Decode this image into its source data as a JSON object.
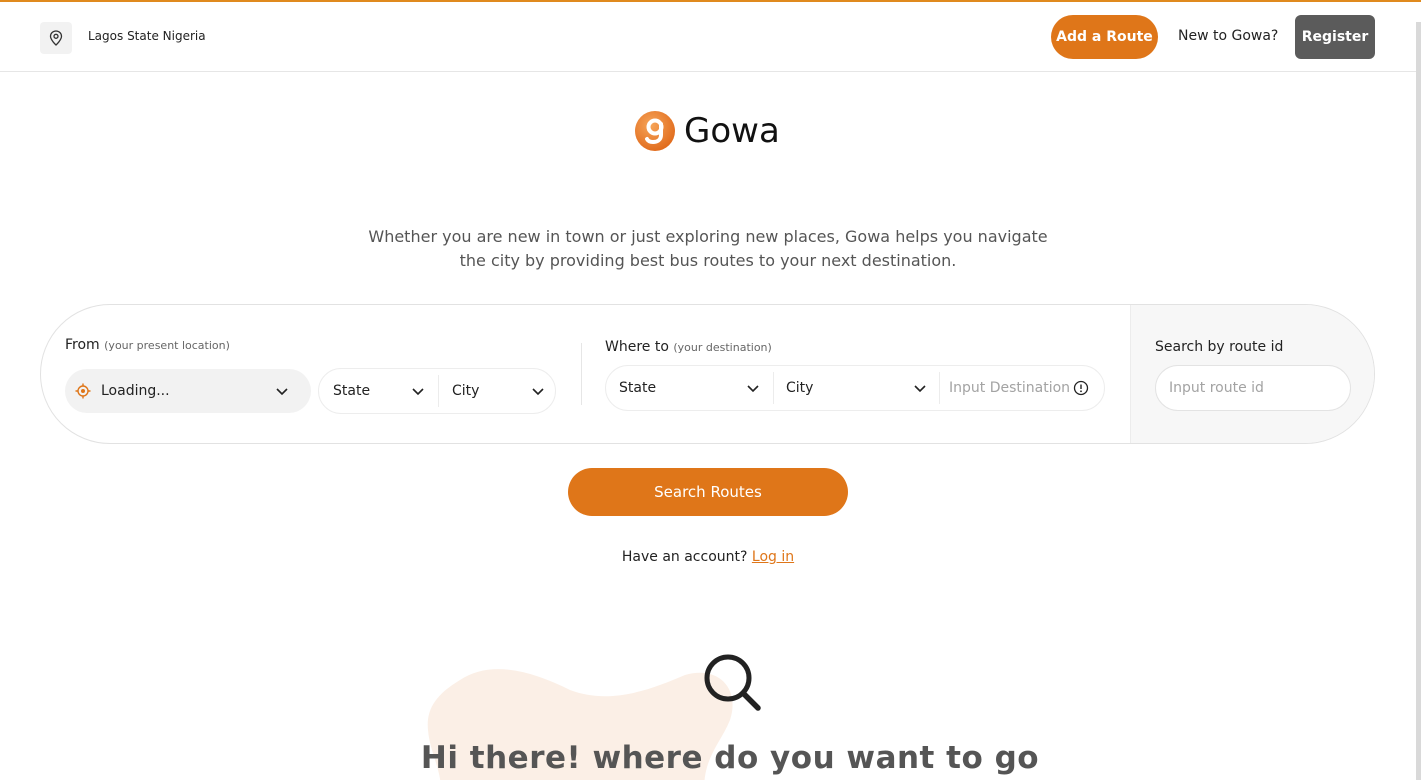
{
  "header": {
    "location_text": "Lagos State Nigeria",
    "add_route_label": "Add a Route",
    "new_to_label": "New to Gowa?",
    "register_label": "Register"
  },
  "brand": {
    "name": "Gowa",
    "logo_glyph": "g"
  },
  "hero": {
    "tagline": "Whether you are new in town or just exploring new places, Gowa helps you navigate the city by providing best bus routes to your next destination."
  },
  "search": {
    "from": {
      "label": "From",
      "hint": "(your present location)",
      "current_location_value": "Loading...",
      "state_placeholder": "State",
      "city_placeholder": "City"
    },
    "to": {
      "label": "Where to",
      "hint": "(your destination)",
      "state_placeholder": "State",
      "city_placeholder": "City",
      "destination_placeholder": "Input Destination"
    },
    "route": {
      "label": "Search by route id",
      "placeholder": "Input route id"
    },
    "submit_label": "Search Routes"
  },
  "auth": {
    "prompt": "Have an account?",
    "login_label": "Log in"
  },
  "empty_state": {
    "heading": "Hi there! where do you want to go"
  },
  "colors": {
    "accent": "#df7619",
    "register_bg": "#5b5b5b",
    "blob": "#fbefe6"
  },
  "icons": {
    "location": "map-pin-icon",
    "current_location": "crosshair-icon",
    "dropdown": "chevron-down-icon",
    "info": "info-icon",
    "search": "magnifier-icon"
  }
}
